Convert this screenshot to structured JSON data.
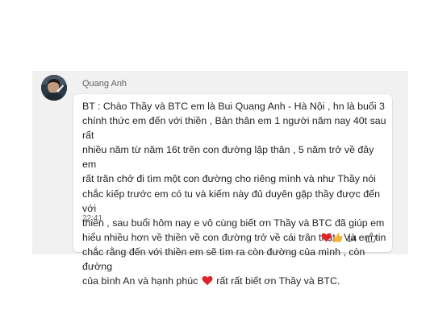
{
  "message": {
    "sender": "Quang Anh",
    "text_before_emoji": "BT : Chào Thầy và BTC em là Bui Quang Anh - Hà Nội , hn là buổi 3\nchính thức em đến với thiền , Bản thân em 1 người năm nay 40t sau rất\nnhiều năm từ năm 16t trên con đường lập thân , 5 năm trở về đây em\nrất trăn chở đi tìm một con đường cho riêng mình và như Thầy nói\nchắc kiếp trước em có tu và kiếm này đủ duyên gặp thầy được đến với\nthiền , sau buổi hôm nay e vô cùng biết ơn Thầy và BTC đã giúp em\nhiểu nhiều hơn về thiền về con đường trở về cái trân thật , Và em tin\nchắc rằng đến với thiền em sẽ tìm ra còn đường của mình , còn đường\ncủa bình An và hạnh phúc ",
    "inline_emoji": "red-heart-icon",
    "text_after_emoji": " rất rất biết ơn Thầy và BTC.",
    "timestamp": "22:41"
  },
  "reactions": {
    "emojis": [
      "red-heart-icon",
      "thumbs-up-icon"
    ],
    "count": "14",
    "add_reaction_icon": "thumbs-up-outline-icon"
  },
  "colors": {
    "background": "#f1f1f1",
    "bubble": "#ffffff",
    "heart": "#e0242a",
    "like": "#f5b335"
  }
}
